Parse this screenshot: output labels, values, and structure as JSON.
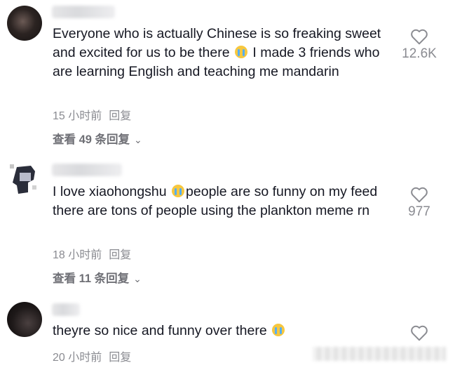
{
  "comments": [
    {
      "text_before": "Everyone who is actually Chinese is so freaking sweet and excited for us to be there ",
      "emoji": "loudly-crying-face-emoji",
      "text_after": " I made 3 friends who are learning English and teaching me mandarin",
      "time": "15 小时前",
      "reply": "回复",
      "view_replies": "查看 49 条回复",
      "likes": "12.6K"
    },
    {
      "text_before": "I love xiaohongshu ",
      "emoji": "loudly-crying-face-emoji",
      "text_after": "people are so funny on my feed there are tons of people using the plankton meme rn",
      "time": "18 小时前",
      "reply": "回复",
      "view_replies": "查看 11 条回复",
      "likes": "977"
    },
    {
      "text_before": "theyre so nice and funny over there ",
      "emoji": "loudly-crying-face-emoji",
      "text_after": "",
      "time": "20 小时前",
      "reply": "回复",
      "likes": ""
    }
  ],
  "colors": {
    "text": "#161823",
    "muted": "#8a8b91",
    "replies": "#6f7076"
  }
}
